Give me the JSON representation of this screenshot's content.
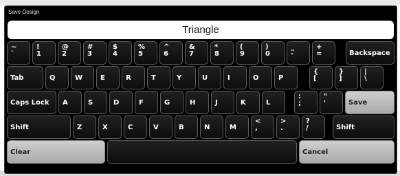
{
  "dialog": {
    "title": "Save Design",
    "name_value": "Triangle"
  },
  "keyboard": {
    "row1": [
      {
        "top": "~",
        "bottom": "`"
      },
      {
        "top": "!",
        "bottom": "1"
      },
      {
        "top": "@",
        "bottom": "2"
      },
      {
        "top": "#",
        "bottom": "3"
      },
      {
        "top": "$",
        "bottom": "4"
      },
      {
        "top": "%",
        "bottom": "5"
      },
      {
        "top": "^",
        "bottom": "6"
      },
      {
        "top": "&",
        "bottom": "7"
      },
      {
        "top": "*",
        "bottom": "8"
      },
      {
        "top": "(",
        "bottom": "9"
      },
      {
        "top": ")",
        "bottom": "0"
      },
      {
        "top": "_",
        "bottom": "-"
      },
      {
        "top": "+",
        "bottom": "="
      }
    ],
    "backspace": "Backspace",
    "tab": "Tab",
    "row2_letters": [
      "Q",
      "W",
      "E",
      "R",
      "T",
      "Y",
      "U",
      "I",
      "O",
      "P"
    ],
    "row2_symbols": [
      {
        "top": "{",
        "bottom": "["
      },
      {
        "top": "}",
        "bottom": "]"
      },
      {
        "top": "|",
        "bottom": "\\"
      }
    ],
    "caps_lock": "Caps Lock",
    "row3_letters": [
      "A",
      "S",
      "D",
      "F",
      "G",
      "H",
      "J",
      "K",
      "L"
    ],
    "row3_symbols": [
      {
        "top": ":",
        "bottom": ";"
      },
      {
        "top": "\"",
        "bottom": "'"
      }
    ],
    "save": "Save",
    "shift_left": "Shift",
    "row4_letters": [
      "Z",
      "X",
      "C",
      "V",
      "B",
      "N",
      "M"
    ],
    "row4_symbols": [
      {
        "top": "<",
        "bottom": ","
      },
      {
        "top": ">",
        "bottom": "."
      },
      {
        "top": "?",
        "bottom": "/"
      }
    ],
    "shift_right": "Shift",
    "clear": "Clear",
    "space": "",
    "cancel": "Cancel"
  }
}
